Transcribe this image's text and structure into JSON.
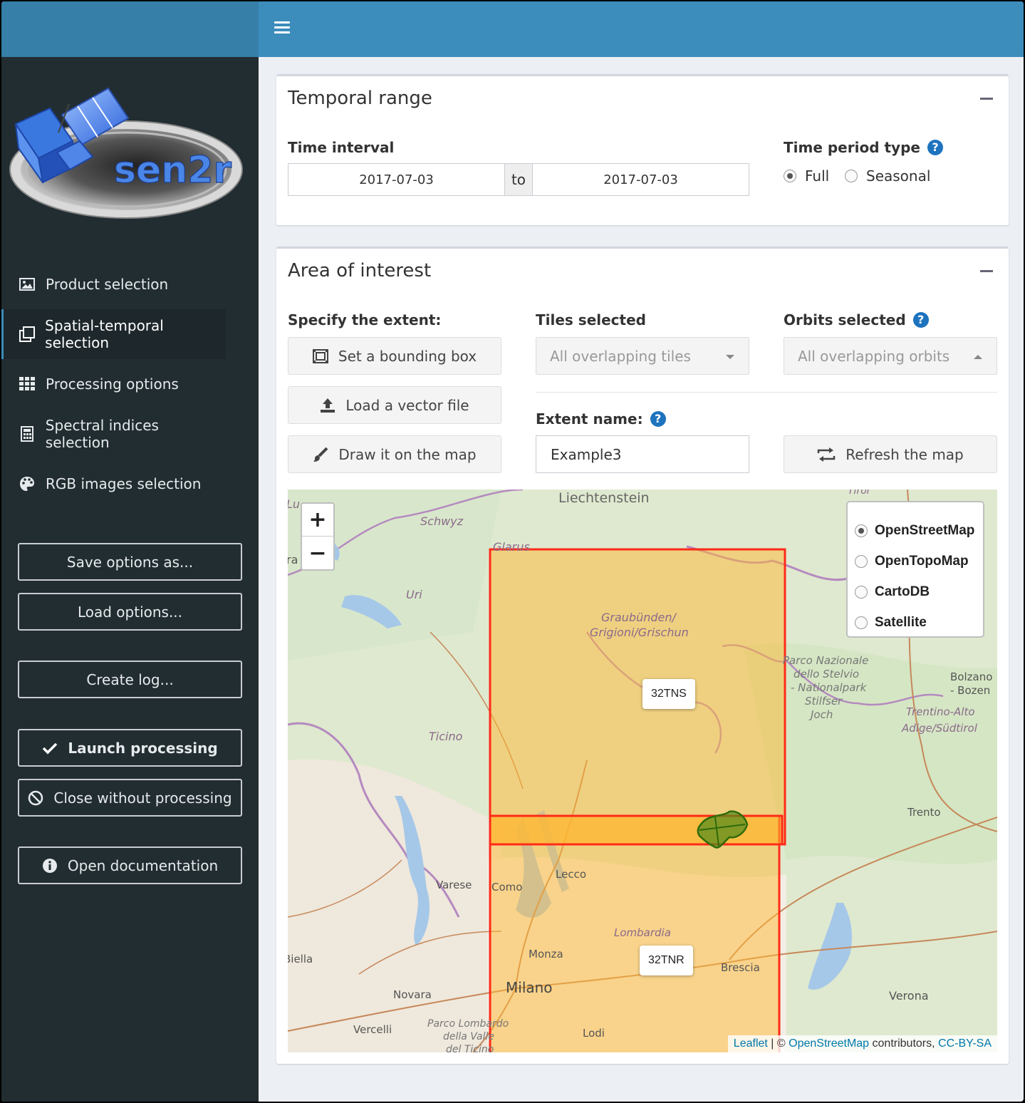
{
  "sidebar": {
    "logo_text": "sen2r",
    "menu": [
      {
        "label": "Product selection",
        "icon": "image-icon"
      },
      {
        "label": "Spatial-temporal selection",
        "icon": "clone-icon"
      },
      {
        "label": "Processing options",
        "icon": "grid-icon"
      },
      {
        "label": "Spectral indices selection",
        "icon": "calculator-icon"
      },
      {
        "label": "RGB images selection",
        "icon": "palette-icon"
      }
    ],
    "active_item": "Spatial-temporal selection",
    "buttons": {
      "save": "Save options as...",
      "load": "Load options...",
      "log": "Create log...",
      "launch": "Launch processing",
      "close": "Close without processing",
      "docs": "Open documentation"
    }
  },
  "temporal": {
    "title": "Temporal range",
    "time_interval_label": "Time interval",
    "date_start": "2017-07-03",
    "date_sep": "to",
    "date_end": "2017-07-03",
    "period_type_label": "Time period type",
    "period_options": [
      "Full",
      "Seasonal"
    ],
    "period_selected": "Full"
  },
  "aoi": {
    "title": "Area of interest",
    "extent_label": "Specify the extent:",
    "bbox_btn": "Set a bounding box",
    "vector_btn": "Load a vector file",
    "draw_btn": "Draw it on the map",
    "tiles_label": "Tiles selected",
    "tiles_value": "All overlapping tiles",
    "orbits_label": "Orbits selected",
    "orbits_value": "All overlapping orbits",
    "extent_name_label": "Extent name:",
    "extent_name_value": "Example3",
    "refresh_btn": "Refresh the map"
  },
  "map": {
    "zoom_in": "+",
    "zoom_out": "−",
    "layers": [
      "OpenStreetMap",
      "OpenTopoMap",
      "CartoDB",
      "Satellite"
    ],
    "layer_selected": "OpenStreetMap",
    "tile_labels": [
      "32TNS",
      "32TNR"
    ],
    "place_names": [
      "Liechtenstein",
      "Schwyz",
      "Glarus",
      "Uri",
      "Graubünden/",
      "Grigioni/Grischun",
      "Ticino",
      "Parco Nazionale",
      "dello Stelvio",
      "- Nationalpark",
      "Stilfser",
      "Joch",
      "Bolzano",
      "- Bozen",
      "Trentino-Alto",
      "Adige/Südtirol",
      "Trento",
      "Varese",
      "Como",
      "Lecco",
      "Lombardia",
      "Monza",
      "Brescia",
      "Milano",
      "Novara",
      "Vercelli",
      "Biella",
      "Parco Lombardo",
      "della Valle",
      "del Ticino",
      "Lodi",
      "Verona",
      "Lu",
      "ra",
      "Tirol"
    ],
    "attribution": {
      "leaflet": "Leaflet",
      "sep": " | © ",
      "osm": "OpenStreetMap",
      "mid": " contributors, ",
      "license": "CC-BY-SA"
    },
    "colors": {
      "tile_fill": "#ffb732",
      "tile_stroke": "#ff2a1a",
      "aoi_fill": "#4f8a1a"
    }
  }
}
